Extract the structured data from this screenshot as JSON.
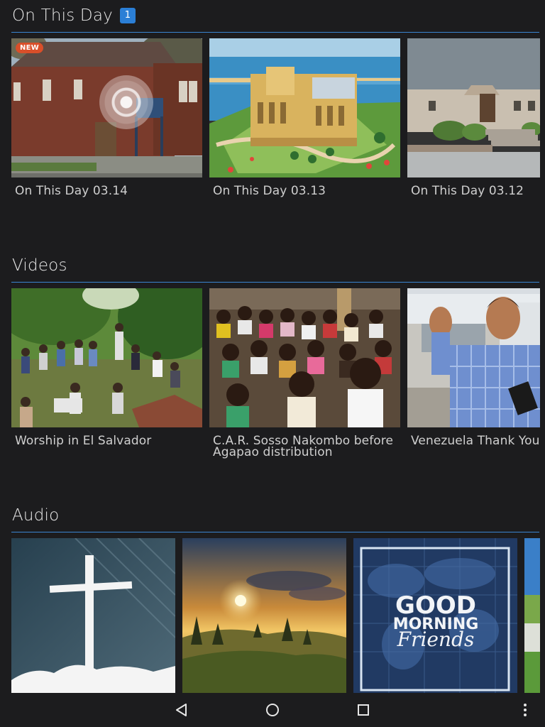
{
  "sections": {
    "on_this_day": {
      "title": "On This Day",
      "badge_count": "1",
      "cards": [
        {
          "title": "On This Day 03.14",
          "badge": "NEW"
        },
        {
          "title": "On This Day 03.13"
        },
        {
          "title": "On This Day 03.12"
        }
      ]
    },
    "videos": {
      "title": "Videos",
      "cards": [
        {
          "title": "Worship in El Salvador"
        },
        {
          "title_line1": "C.A.R. Sosso Nakombo before",
          "title_line2": "Agapao distribution"
        },
        {
          "title": "Venezuela Thank You"
        }
      ]
    },
    "audio": {
      "title": "Audio",
      "cards": [
        {
          "image": "cross-artwork"
        },
        {
          "image": "sunrise-landscape"
        },
        {
          "image": "good-morning-friends-artwork",
          "art_line1": "GOOD",
          "art_line2": "MORNING",
          "art_line3": "Friends"
        },
        {
          "image": "partial-landscape"
        }
      ]
    }
  },
  "nav": {
    "back": "back-icon",
    "home": "home-icon",
    "recents": "recents-icon",
    "menu": "overflow-menu-icon"
  },
  "colors": {
    "background": "#1c1c1e",
    "accent": "#3b86d2",
    "badge_blue": "#2b7fd6",
    "new_badge": "#d94f2a"
  }
}
